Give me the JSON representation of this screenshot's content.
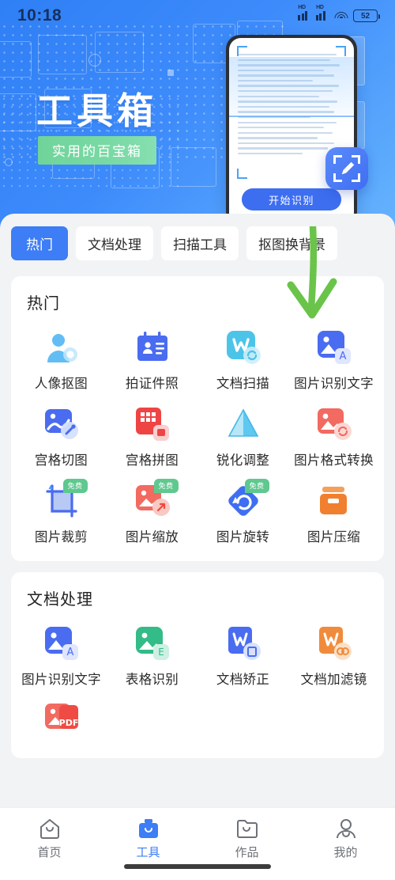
{
  "status_bar": {
    "time": "10:18",
    "signal1_label": "HD",
    "signal2_label": "HD",
    "wifi_icon": "wifi-icon",
    "battery_level": "52"
  },
  "header": {
    "title": "工具箱",
    "subtitle": "实用的百宝箱",
    "phone_mockup": {
      "start_button": "开始识别",
      "edit_badge_icon": "scan-edit-icon"
    },
    "gradient_from": "#2f7ff5",
    "gradient_to": "#66b4fd",
    "subtitle_bg": "#6fd49a"
  },
  "tabs": [
    {
      "label": "热门",
      "active": true
    },
    {
      "label": "文档处理",
      "active": false
    },
    {
      "label": "扫描工具",
      "active": false
    },
    {
      "label": "抠图换背景",
      "active": false
    }
  ],
  "sections": [
    {
      "title": "热门",
      "items": [
        {
          "label": "人像抠图",
          "icon": "portrait-cutout-icon",
          "color": "#6ec4f7",
          "badge": ""
        },
        {
          "label": "拍证件照",
          "icon": "id-photo-icon",
          "color": "#4a6cf0",
          "badge": ""
        },
        {
          "label": "文档扫描",
          "icon": "document-scan-icon",
          "color": "#4cc4e8",
          "badge": ""
        },
        {
          "label": "图片识别文字",
          "icon": "image-to-text-icon",
          "color": "#4a6cf0",
          "badge": ""
        },
        {
          "label": "宫格切图",
          "icon": "grid-cut-icon",
          "color": "#4a6cf0",
          "badge": ""
        },
        {
          "label": "宫格拼图",
          "icon": "grid-collage-icon",
          "color": "#ef4444",
          "badge": ""
        },
        {
          "label": "锐化调整",
          "icon": "sharpen-adjust-icon",
          "color": "#5ec8f0",
          "badge": ""
        },
        {
          "label": "图片格式转换",
          "icon": "image-format-convert-icon",
          "color": "#f26a60",
          "badge": ""
        },
        {
          "label": "图片裁剪",
          "icon": "image-crop-icon",
          "color": "#6a8ef0",
          "badge": "免费"
        },
        {
          "label": "图片缩放",
          "icon": "image-resize-icon",
          "color": "#f26a60",
          "badge": "免费"
        },
        {
          "label": "图片旋转",
          "icon": "image-rotate-icon",
          "color": "#3f6ef2",
          "badge": "免费"
        },
        {
          "label": "图片压缩",
          "icon": "image-compress-icon",
          "color": "#f08040",
          "badge": ""
        }
      ]
    },
    {
      "title": "文档处理",
      "items": [
        {
          "label": "图片识别文字",
          "icon": "image-to-text-icon",
          "color": "#4a6cf0",
          "badge": ""
        },
        {
          "label": "表格识别",
          "icon": "table-recognition-icon",
          "color": "#33bb88",
          "badge": ""
        },
        {
          "label": "文档矫正",
          "icon": "document-correct-icon",
          "color": "#4a6cf0",
          "badge": ""
        },
        {
          "label": "文档加滤镜",
          "icon": "document-filter-icon",
          "color": "#f08b3c",
          "badge": ""
        },
        {
          "label": "",
          "icon": "image-to-pdf-icon",
          "color": "#f26a60",
          "badge": ""
        }
      ]
    }
  ],
  "annotation": {
    "arrow_icon": "down-arrow-annotation",
    "color": "#6ac44a",
    "points_to": "图片识别文字"
  },
  "bottom_nav": [
    {
      "label": "首页",
      "icon": "home-icon",
      "active": false
    },
    {
      "label": "工具",
      "icon": "toolbox-icon",
      "active": true
    },
    {
      "label": "作品",
      "icon": "folder-icon",
      "active": false
    },
    {
      "label": "我的",
      "icon": "user-icon",
      "active": false
    }
  ],
  "colors": {
    "accent": "#3d7df5",
    "free_badge": "#5fc88f",
    "sheet_bg": "#f2f3f5"
  }
}
